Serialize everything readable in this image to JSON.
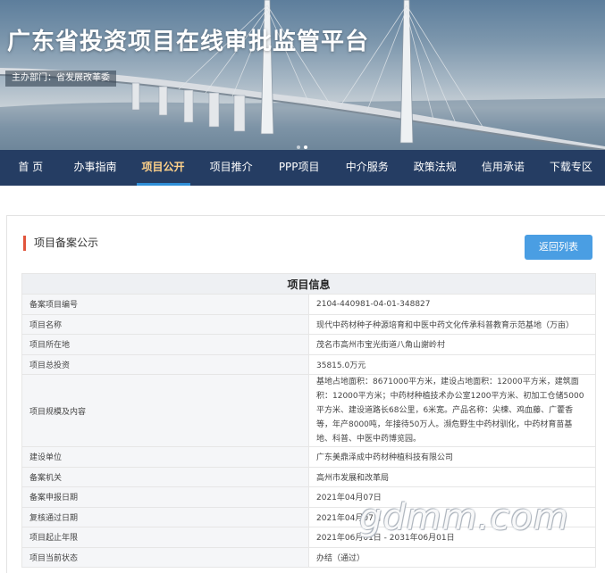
{
  "header": {
    "site_title": "广东省投资项目在线审批监管平台",
    "sponsor": "主办部门：省发展改革委"
  },
  "nav": {
    "items": [
      {
        "label": "首 页"
      },
      {
        "label": "办事指南"
      },
      {
        "label": "项目公开"
      },
      {
        "label": "项目推介"
      },
      {
        "label": "PPP项目"
      },
      {
        "label": "中介服务"
      },
      {
        "label": "政策法规"
      },
      {
        "label": "信用承诺"
      },
      {
        "label": "下载专区"
      }
    ],
    "active_index": 2
  },
  "section": {
    "title": "项目备案公示",
    "back_button": "返回列表"
  },
  "table": {
    "heading": "项目信息",
    "rows": [
      {
        "label": "备案项目编号",
        "value": "2104-440981-04-01-348827"
      },
      {
        "label": "项目名称",
        "value": "现代中药材种子种源培育和中医中药文化传承科普教育示范基地（万亩）"
      },
      {
        "label": "项目所在地",
        "value": "茂名市高州市宝光街道八角山謝岭村"
      },
      {
        "label": "项目总投资",
        "value": "35815.0万元"
      },
      {
        "label": "项目规模及内容",
        "value": "基地占地面积：8671000平方米，建设占地面积：12000平方米，建筑面积：12000平方米；中药材种植技术办公室1200平方米、初加工仓储5000平方米、建设道路长68公里，6米宽。产品名称：尖楝、鸡血藤、广藿香等，年产8000吨，年接待50万人。濒危野生中药材驯化，中药材育苗基地、科普、中医中药博览园。"
      },
      {
        "label": "建设单位",
        "value": "广东美鼎泽成中药材种植科技有限公司"
      },
      {
        "label": "备案机关",
        "value": "高州市发展和改革局"
      },
      {
        "label": "备案申报日期",
        "value": "2021年04月07日"
      },
      {
        "label": "复核通过日期",
        "value": "2021年04月07日"
      },
      {
        "label": "项目起止年限",
        "value": "2021年06月01日 - 2031年06月01日"
      },
      {
        "label": "项目当前状态",
        "value": "办结（通过）"
      }
    ]
  },
  "watermark": "gdmm.com",
  "colors": {
    "nav_bg": "#253d63",
    "nav_active_text": "#ffd28a",
    "nav_active_underline": "#2f8fd8",
    "section_marker": "#e1553c",
    "button_bg": "#4a9ee3"
  }
}
